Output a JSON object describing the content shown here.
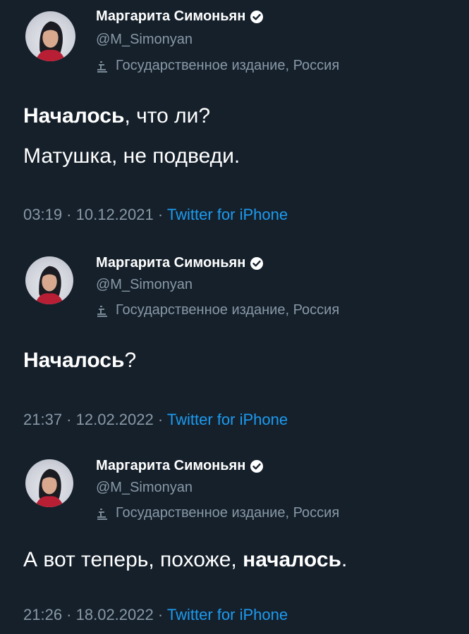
{
  "colors": {
    "background": "#15202b",
    "primary_text": "#ffffff",
    "secondary_text": "#8899a6",
    "link": "#1d9bf0"
  },
  "tweets": [
    {
      "author_name": "Маргарита Симоньян",
      "handle": "@M_Simonyan",
      "label": "Государственное издание, Россия",
      "text_bold": "Началось",
      "text_rest": ", что ли?",
      "text_line2": "Матушка, не подведи.",
      "time": "03:19",
      "date": "10.12.2021",
      "source": "Twitter for iPhone",
      "icon": "verified-badge-icon"
    },
    {
      "author_name": "Маргарита Симоньян",
      "handle": "@M_Simonyan",
      "label": "Государственное издание, Россия",
      "text_bold": "Началось",
      "text_rest": "?",
      "time": "21:37",
      "date": "12.02.2022",
      "source": "Twitter for iPhone",
      "icon": "verified-badge-icon"
    },
    {
      "author_name": "Маргарита Симоньян",
      "handle": "@M_Simonyan",
      "label": "Государственное издание, Россия",
      "text_pre": "А вот теперь, похоже, ",
      "text_bold": "началось",
      "text_end": ".",
      "time": "21:26",
      "date": "18.02.2022",
      "source": "Twitter for iPhone",
      "icon": "verified-badge-icon"
    }
  ]
}
